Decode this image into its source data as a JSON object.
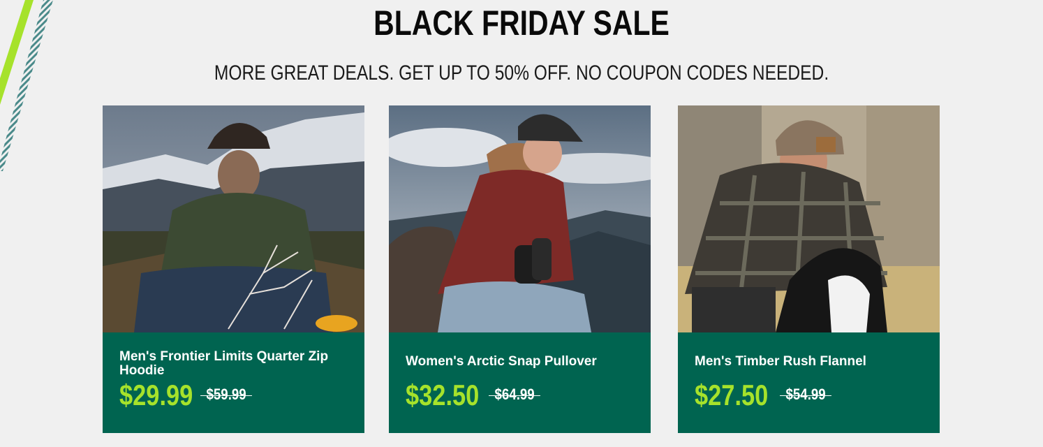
{
  "promo": {
    "title": "BLACK FRIDAY SALE",
    "subtitle": "MORE GREAT DEALS. GET UP TO 50% OFF. NO COUPON CODES NEEDED."
  },
  "colors": {
    "background": "#f0f0f0",
    "card_background": "#006450",
    "sale_price": "#a6e22b",
    "accent_stripe": "#a6e22b",
    "stripe_teal": "#4a8a8a"
  },
  "products": [
    {
      "name": "Men's Frontier Limits Quarter Zip Hoodie",
      "price": "$29.99",
      "original_price": "$59.99",
      "image": "man-crouching-mountain-green-pullover-photo"
    },
    {
      "name": "Women's Arctic Snap Pullover",
      "price": "$32.50",
      "original_price": "$64.99",
      "image": "woman-binoculars-red-pullover-photo"
    },
    {
      "name": "Men's Timber Rush Flannel",
      "price": "$27.50",
      "original_price": "$54.99",
      "image": "man-flannel-beanie-dog-photo"
    }
  ]
}
